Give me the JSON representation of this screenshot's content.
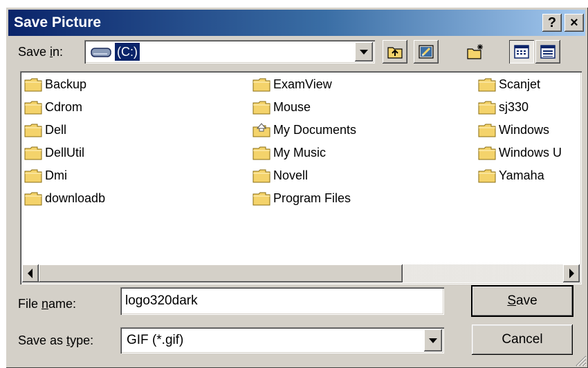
{
  "window": {
    "title": "Save Picture",
    "help_button": "?",
    "close_button": "×"
  },
  "save_in": {
    "label_pre": "Save ",
    "label_underlined": "i",
    "label_post": "n:",
    "value": "(C:)"
  },
  "toolbar": {
    "up_one_level_icon": "up-folder-icon",
    "desktop_icon": "desktop-icon",
    "new_folder_icon": "new-folder-icon",
    "list_view_icon": "list-view-icon",
    "details_view_icon": "details-view-icon"
  },
  "files": {
    "col1": [
      "Backup",
      "Cdrom",
      "Dell",
      "DellUtil",
      "Dmi",
      "downloadb"
    ],
    "col2": [
      "ExamView",
      "Mouse",
      "My Documents",
      "My Music",
      "Novell",
      "Program Files"
    ],
    "col3": [
      "Scanjet",
      "sj330",
      "Windows",
      "Windows U",
      "Yamaha"
    ]
  },
  "file_name": {
    "label_pre": "File ",
    "label_underlined": "n",
    "label_post": "ame:",
    "value": "logo320dark"
  },
  "save_as_type": {
    "label_pre": "Save as ",
    "label_underlined": "t",
    "label_post": "ype:",
    "value": "GIF (*.gif)"
  },
  "buttons": {
    "save_underlined": "S",
    "save_rest": "ave",
    "cancel": "Cancel"
  },
  "colors": {
    "title_start": "#0a246a",
    "title_end": "#a6caf0",
    "face": "#d4d0c8",
    "selection": "#0a246a",
    "folder": "#f4d36b"
  }
}
